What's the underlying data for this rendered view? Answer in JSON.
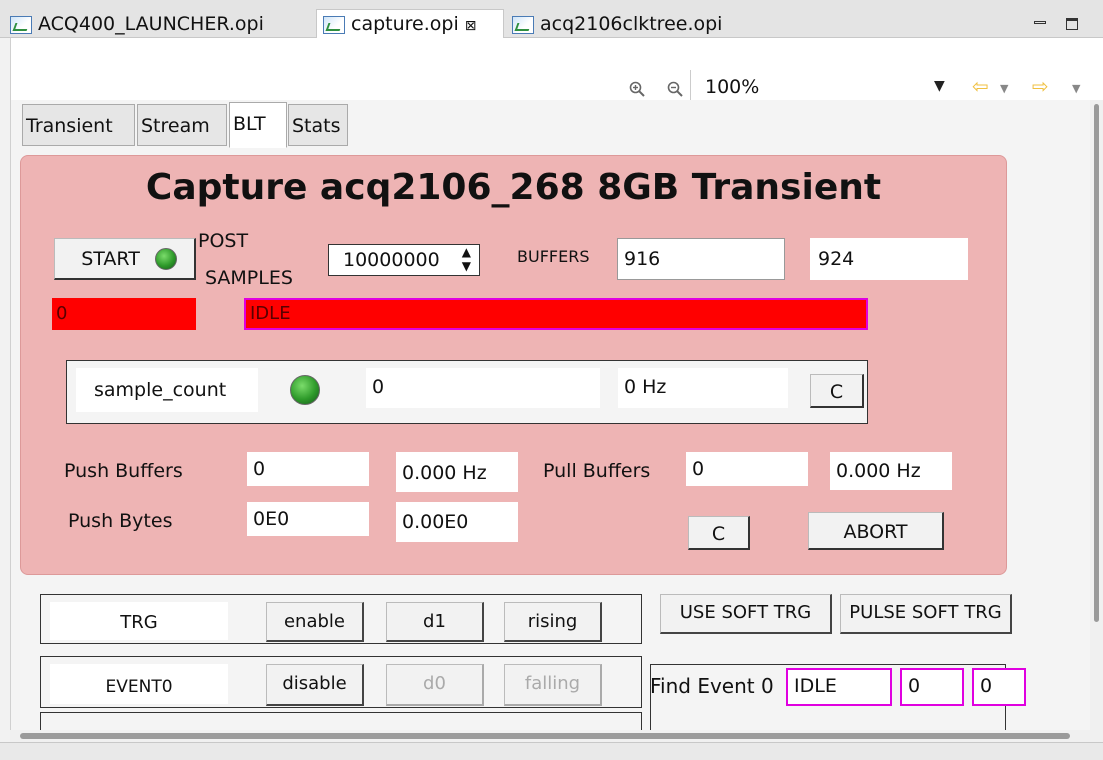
{
  "editor_tabs": [
    {
      "label": "ACQ400_LAUNCHER.opi"
    },
    {
      "label": "capture.opi",
      "close": "⊠"
    },
    {
      "label": "acq2106clktree.opi"
    }
  ],
  "toolbar": {
    "zoom": "100%"
  },
  "inner_tabs": [
    "Transient",
    "Stream",
    "BLT",
    "Stats"
  ],
  "panel": {
    "title": "Capture acq2106_268 8GB Transient",
    "start_label": "START",
    "post_label_1": "POST",
    "post_label_2": "SAMPLES",
    "post_value": "10000000",
    "buffers_label": "BUFFERS",
    "buffers_a": "916",
    "buffers_b": "924",
    "count_value": "0",
    "state_value": "IDLE",
    "sample_count_label": "sample_count",
    "sample_count_value": "0",
    "sample_rate": "0 Hz",
    "c_label": "C",
    "push_buffers_label": "Push Buffers",
    "push_buffers_value": "0",
    "push_buffers_rate": "0.000 Hz",
    "pull_buffers_label": "Pull Buffers",
    "pull_buffers_value": "0",
    "pull_buffers_rate": "0.000 Hz",
    "push_bytes_label": "Push Bytes",
    "push_bytes_value": "0E0",
    "push_bytes_rate": "0.00E0",
    "abort_label": "ABORT"
  },
  "trg_row": {
    "name": "TRG",
    "enable": "enable",
    "channel": "d1",
    "edge": "rising"
  },
  "event0_row": {
    "name": "EVENT0",
    "enable": "disable",
    "channel": "d0",
    "edge": "falling"
  },
  "soft": {
    "use_soft_trg": "USE SOFT TRG",
    "pulse_soft_trg": "PULSE SOFT TRG"
  },
  "find_event": {
    "label": "Find Event 0",
    "state": "IDLE",
    "v1": "0",
    "v2": "0"
  }
}
